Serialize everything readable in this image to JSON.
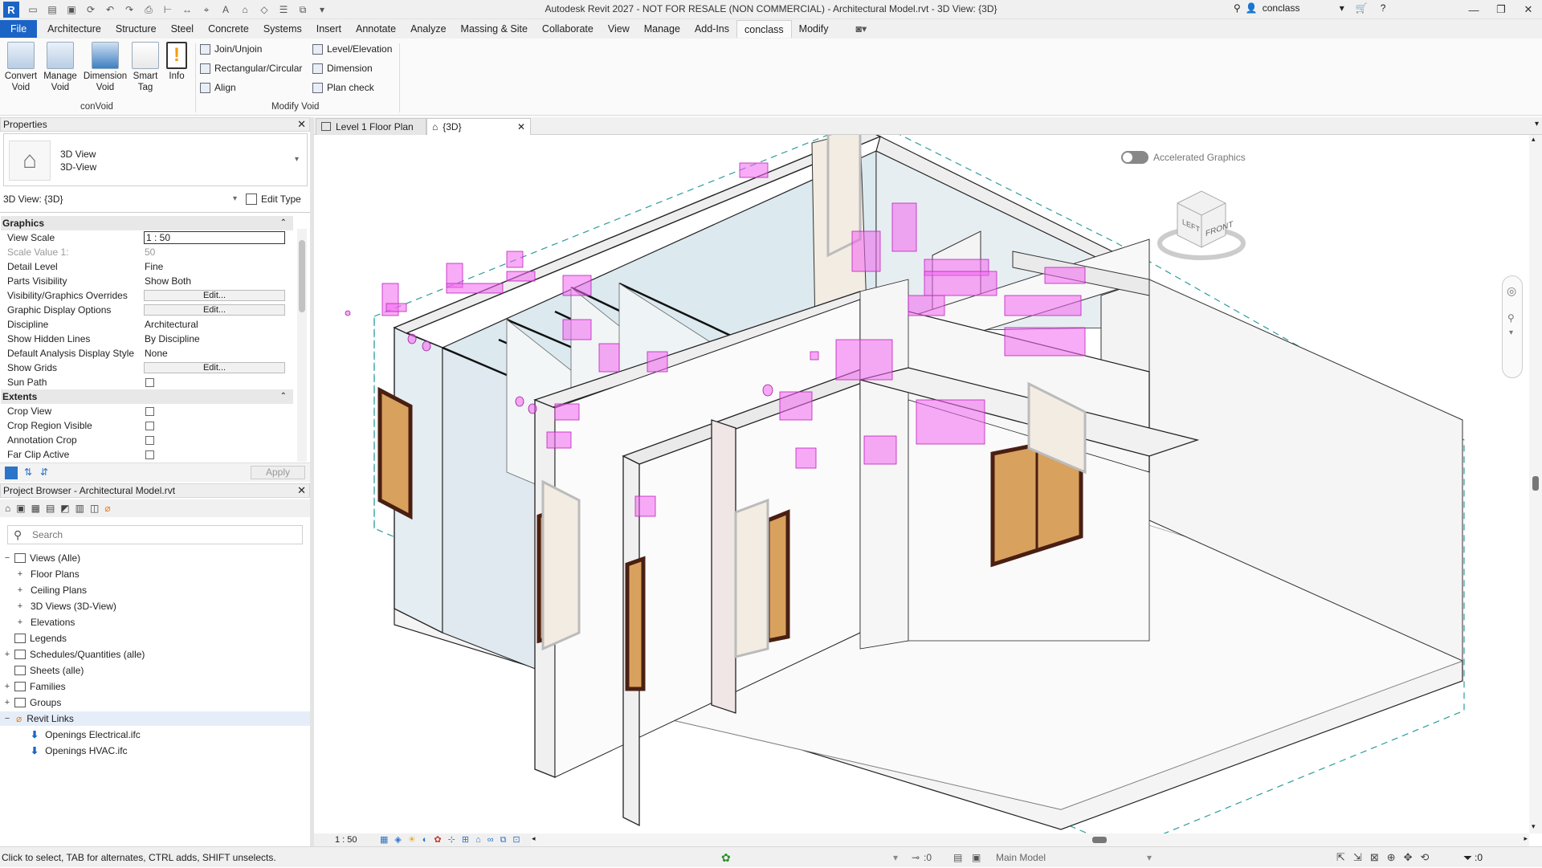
{
  "titlebar": {
    "app_logo": "R",
    "title": "Autodesk Revit 2027 - NOT FOR RESALE (NON COMMERCIAL) - Architectural Model.rvt - 3D View: {3D}",
    "user": "conclass",
    "window_buttons": [
      "—",
      "❐",
      "✕"
    ]
  },
  "ribbon_tabs": [
    "File",
    "Architecture",
    "Structure",
    "Steel",
    "Concrete",
    "Systems",
    "Insert",
    "Annotate",
    "Analyze",
    "Massing & Site",
    "Collaborate",
    "View",
    "Manage",
    "Add-Ins",
    "conclass",
    "Modify"
  ],
  "ribbon": {
    "convoid_buttons": [
      {
        "label": "Convert Void"
      },
      {
        "label": "Manage Void"
      },
      {
        "label": "Dimension Void"
      },
      {
        "label": "Smart Tag"
      },
      {
        "label": "Info"
      }
    ],
    "convoid_panel": "conVoid",
    "modify_col1": [
      "Join/Unjoin",
      "Rectangular/Circular",
      "Align"
    ],
    "modify_col2": [
      "Level/Elevation",
      "Dimension",
      "Plan check"
    ],
    "modify_panel": "Modify Void"
  },
  "properties": {
    "title": "Properties",
    "type_name": "3D View",
    "type_sub": "3D-View",
    "selector": "3D View: {3D}",
    "edit_type": "Edit Type",
    "groups": {
      "graphics": "Graphics",
      "extents": "Extents"
    },
    "rows": {
      "view_scale": {
        "name": "View Scale",
        "value": "1 : 50"
      },
      "scale_value": {
        "name": "Scale Value    1:",
        "value": "50"
      },
      "detail_level": {
        "name": "Detail Level",
        "value": "Fine"
      },
      "parts_visibility": {
        "name": "Parts Visibility",
        "value": "Show Both"
      },
      "vg_overrides": {
        "name": "Visibility/Graphics Overrides",
        "value": "Edit..."
      },
      "graphic_display": {
        "name": "Graphic Display Options",
        "value": "Edit..."
      },
      "discipline": {
        "name": "Discipline",
        "value": "Architectural"
      },
      "hidden_lines": {
        "name": "Show Hidden Lines",
        "value": "By Discipline"
      },
      "analysis_style": {
        "name": "Default Analysis Display Style",
        "value": "None"
      },
      "show_grids": {
        "name": "Show Grids",
        "value": "Edit..."
      },
      "sun_path": {
        "name": "Sun Path"
      },
      "crop_view": {
        "name": "Crop View"
      },
      "crop_region": {
        "name": "Crop Region Visible"
      },
      "annotation_crop": {
        "name": "Annotation Crop"
      },
      "far_clip": {
        "name": "Far Clip Active"
      }
    },
    "apply": "Apply"
  },
  "browser": {
    "title": "Project Browser - Architectural Model.rvt",
    "search_placeholder": "Search",
    "nodes": [
      {
        "label": "Views (Alle)",
        "exp": "−"
      },
      {
        "label": "Floor Plans",
        "exp": "+"
      },
      {
        "label": "Ceiling Plans",
        "exp": "+"
      },
      {
        "label": "3D Views (3D-View)",
        "exp": "+"
      },
      {
        "label": "Elevations",
        "exp": "+"
      },
      {
        "label": "Legends",
        "exp": ""
      },
      {
        "label": "Schedules/Quantities (alle)",
        "exp": "+"
      },
      {
        "label": "Sheets (alle)",
        "exp": ""
      },
      {
        "label": "Families",
        "exp": "+"
      },
      {
        "label": "Groups",
        "exp": "+"
      },
      {
        "label": "Revit Links",
        "exp": "−"
      },
      {
        "label": "Openings Electrical.ifc",
        "exp": ""
      },
      {
        "label": "Openings HVAC.ifc",
        "exp": ""
      }
    ]
  },
  "view_tabs": [
    "Level 1 Floor Plan",
    "{3D}"
  ],
  "view": {
    "accelerated_graphics": "Accelerated Graphics",
    "viewcube_front": "FRONT",
    "viewcube_left": "LEFT",
    "scale": "1 : 50"
  },
  "status": {
    "hint": "Click to select, TAB for alternates, CTRL adds, SHIFT unselects.",
    "worksets": ":0",
    "model": "Main Model",
    "filter": ":0"
  },
  "colors": {
    "accent": "#1b64c5",
    "void": "#f266ee",
    "door": "#d8a15e",
    "door_frame": "#4a1f12",
    "glass": "#dce9ef",
    "crop": "#2e9c9c"
  }
}
